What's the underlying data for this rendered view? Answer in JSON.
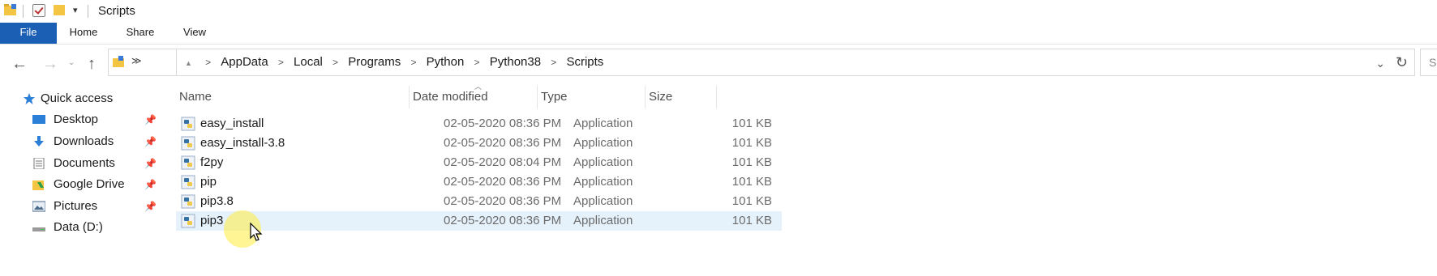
{
  "window": {
    "title": "Scripts"
  },
  "ribbon": {
    "tabs": [
      "File",
      "Home",
      "Share",
      "View"
    ]
  },
  "address": {
    "crumbs": [
      "AppData",
      "Local",
      "Programs",
      "Python",
      "Python38",
      "Scripts"
    ],
    "separator": ">"
  },
  "search": {
    "placeholder": "Se"
  },
  "sidebar": {
    "items": [
      {
        "label": "Quick access",
        "icon": "star-icon",
        "pinned": false
      },
      {
        "label": "Desktop",
        "icon": "desktop-icon",
        "pinned": true
      },
      {
        "label": "Downloads",
        "icon": "download-icon",
        "pinned": true
      },
      {
        "label": "Documents",
        "icon": "documents-icon",
        "pinned": true
      },
      {
        "label": "Google Drive",
        "icon": "google-drive-icon",
        "pinned": true
      },
      {
        "label": "Pictures",
        "icon": "pictures-icon",
        "pinned": true
      },
      {
        "label": "Data (D:)",
        "icon": "drive-icon",
        "pinned": false
      }
    ]
  },
  "table": {
    "columns": [
      "Name",
      "Date modified",
      "Type",
      "Size"
    ],
    "rows": [
      {
        "name": "easy_install",
        "date": "02-05-2020 08:36 PM",
        "type": "Application",
        "size": "101 KB"
      },
      {
        "name": "easy_install-3.8",
        "date": "02-05-2020 08:36 PM",
        "type": "Application",
        "size": "101 KB"
      },
      {
        "name": "f2py",
        "date": "02-05-2020 08:04 PM",
        "type": "Application",
        "size": "101 KB"
      },
      {
        "name": "pip",
        "date": "02-05-2020 08:36 PM",
        "type": "Application",
        "size": "101 KB"
      },
      {
        "name": "pip3.8",
        "date": "02-05-2020 08:36 PM",
        "type": "Application",
        "size": "101 KB"
      },
      {
        "name": "pip3",
        "date": "02-05-2020 08:36 PM",
        "type": "Application",
        "size": "101 KB"
      }
    ],
    "selected_row": 5
  },
  "colors": {
    "accent": "#1a5fb4",
    "selection": "#e5f1fb",
    "folder": "#f4c542"
  }
}
